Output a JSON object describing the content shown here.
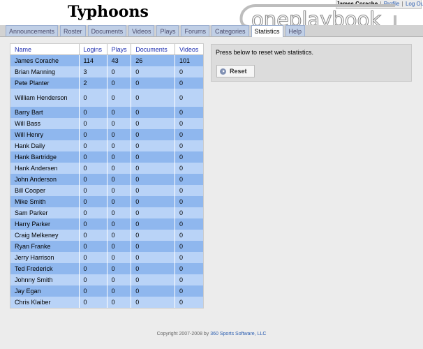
{
  "team_name": "Typhoons",
  "user": {
    "name": "James Corache",
    "profile_link": "Profile",
    "logout_link": "Log Out",
    "separator": "|"
  },
  "logo": {
    "text": "oneplaybook"
  },
  "tabs": [
    {
      "label": "Announcements",
      "active": false
    },
    {
      "label": "Roster",
      "active": false
    },
    {
      "label": "Documents",
      "active": false
    },
    {
      "label": "Videos",
      "active": false
    },
    {
      "label": "Plays",
      "active": false
    },
    {
      "label": "Forums",
      "active": false
    },
    {
      "label": "Categories",
      "active": false
    },
    {
      "label": "Statistics",
      "active": true
    },
    {
      "label": "Help",
      "active": false
    }
  ],
  "stats_table": {
    "columns": [
      "Name",
      "Logins",
      "Plays",
      "Documents",
      "Videos"
    ],
    "rows": [
      [
        "James Corache",
        "114",
        "43",
        "26",
        "101"
      ],
      [
        "Brian Manning",
        "3",
        "0",
        "0",
        "0"
      ],
      [
        "Pete Planter",
        "2",
        "0",
        "0",
        "0"
      ],
      [
        "William Henderson",
        "0",
        "0",
        "0",
        "0"
      ],
      [
        "Barry Bart",
        "0",
        "0",
        "0",
        "0"
      ],
      [
        "Will Bass",
        "0",
        "0",
        "0",
        "0"
      ],
      [
        "Will Henry",
        "0",
        "0",
        "0",
        "0"
      ],
      [
        "Hank Daily",
        "0",
        "0",
        "0",
        "0"
      ],
      [
        "Hank Bartridge",
        "0",
        "0",
        "0",
        "0"
      ],
      [
        "Hank Andersen",
        "0",
        "0",
        "0",
        "0"
      ],
      [
        "John Anderson",
        "0",
        "0",
        "0",
        "0"
      ],
      [
        "Bill Cooper",
        "0",
        "0",
        "0",
        "0"
      ],
      [
        "Mike Smith",
        "0",
        "0",
        "0",
        "0"
      ],
      [
        "Sam Parker",
        "0",
        "0",
        "0",
        "0"
      ],
      [
        "Harry Parker",
        "0",
        "0",
        "0",
        "0"
      ],
      [
        "Craig Melkeney",
        "0",
        "0",
        "0",
        "0"
      ],
      [
        "Ryan Franke",
        "0",
        "0",
        "0",
        "0"
      ],
      [
        "Jerry Harrison",
        "0",
        "0",
        "0",
        "0"
      ],
      [
        "Ted Frederick",
        "0",
        "0",
        "0",
        "0"
      ],
      [
        "Johnny Smith",
        "0",
        "0",
        "0",
        "0"
      ],
      [
        "Jay Egan",
        "0",
        "0",
        "0",
        "0"
      ],
      [
        "Chris Klaiber",
        "0",
        "0",
        "0",
        "0"
      ]
    ]
  },
  "reset_panel": {
    "text": "Press below to reset web statistics.",
    "button_label": "Reset",
    "icon": "arrow-circle-icon"
  },
  "footer": {
    "copyright": "Copyright 2007-2008 by ",
    "company": "360 Sports Software, LLC"
  },
  "colors": {
    "row_odd": "#8fb7ee",
    "row_even": "#b9d3f7",
    "link": "#2a5db0",
    "tab": "#c0cfe6"
  }
}
